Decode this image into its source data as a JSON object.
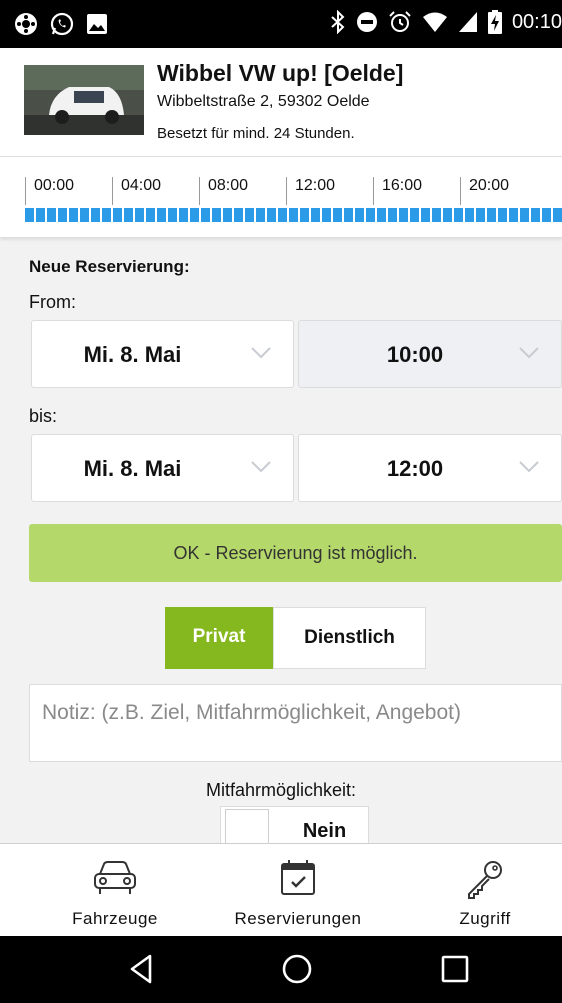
{
  "status_bar": {
    "time": "00:10"
  },
  "header": {
    "title": "Wibbel VW up! [Oelde]",
    "address": "Wibbeltstraße 2, 59302 Oelde",
    "status": "Besetzt für mind. 24 Stunden."
  },
  "timeline": {
    "hours": [
      "00:00",
      "04:00",
      "08:00",
      "12:00",
      "16:00",
      "20:00"
    ],
    "occupancy_color": "#2b9be8"
  },
  "form": {
    "title": "Neue Reservierung:",
    "from_label": "From:",
    "from_date": "Mi. 8. Mai",
    "from_time": "10:00",
    "to_label": "bis:",
    "to_date": "Mi. 8. Mai",
    "to_time": "12:00",
    "status_message": "OK - Reservierung ist möglich.",
    "status_color": "#b5d86a",
    "type_options": [
      "Privat",
      "Dienstlich"
    ],
    "type_selected": "Privat",
    "accent_color": "#85b81f",
    "note_placeholder": "Notiz: (z.B. Ziel, Mitfahrmöglichkeit, Angebot)",
    "note_value": "",
    "ride_share_label": "Mitfahrmöglichkeit:",
    "ride_share_value": "Nein"
  },
  "bottom_nav": {
    "items": [
      {
        "label": "Fahrzeuge",
        "icon": "car-icon"
      },
      {
        "label": "Reservierungen",
        "icon": "calendar-check-icon"
      },
      {
        "label": "Zugriff",
        "icon": "key-icon"
      }
    ]
  }
}
